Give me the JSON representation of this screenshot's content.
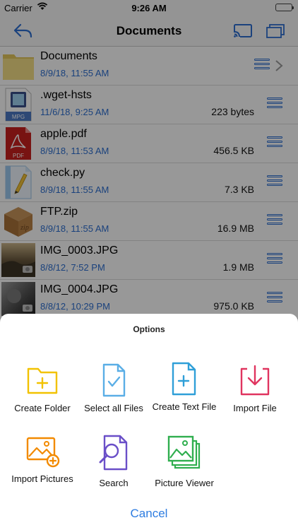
{
  "status_bar": {
    "carrier": "Carrier",
    "time": "9:26 AM"
  },
  "nav": {
    "title": "Documents",
    "back_icon": "back-arrow-icon",
    "cast_icon": "cast-icon",
    "windows_icon": "windows-icon"
  },
  "files": [
    {
      "name": "Documents",
      "date": "8/9/18, 11:55 AM",
      "size": "",
      "type": "folder"
    },
    {
      "name": ".wget-hsts",
      "date": "11/6/18, 9:25 AM",
      "size": "223 bytes",
      "type": "mpg"
    },
    {
      "name": "apple.pdf",
      "date": "8/9/18, 11:53 AM",
      "size": "456.5 KB",
      "type": "pdf"
    },
    {
      "name": "check.py",
      "date": "8/9/18, 11:55 AM",
      "size": "7.3 KB",
      "type": "py"
    },
    {
      "name": "FTP.zip",
      "date": "8/9/18, 11:55 AM",
      "size": "16.9 MB",
      "type": "zip"
    },
    {
      "name": "IMG_0003.JPG",
      "date": "8/8/12, 7:52 PM",
      "size": "1.9 MB",
      "type": "jpg"
    },
    {
      "name": "IMG_0004.JPG",
      "date": "8/8/12, 10:29 PM",
      "size": "975.0 KB",
      "type": "jpg"
    }
  ],
  "thumb_labels": {
    "mpg": "MPG",
    "pdf": "PDF",
    "zip": "zip"
  },
  "sheet": {
    "title": "Options",
    "options": [
      {
        "label": "Create Folder",
        "icon": "create-folder-icon",
        "color": "#f2c200"
      },
      {
        "label": "Select all Files",
        "icon": "select-all-files-icon",
        "color": "#5aaee6"
      },
      {
        "label": "Create Text File",
        "icon": "create-text-file-icon",
        "color": "#2f9fd8"
      },
      {
        "label": "Import File",
        "icon": "import-file-icon",
        "color": "#e0345f"
      },
      {
        "label": "Import Pictures",
        "icon": "import-pictures-icon",
        "color": "#f28a00"
      },
      {
        "label": "Search",
        "icon": "search-icon",
        "color": "#6a4fc8"
      },
      {
        "label": "Picture Viewer",
        "icon": "picture-viewer-icon",
        "color": "#2fae4e"
      }
    ],
    "cancel": "Cancel"
  },
  "colors": {
    "accent": "#2d6fd1",
    "cancel": "#2d7ce0"
  }
}
